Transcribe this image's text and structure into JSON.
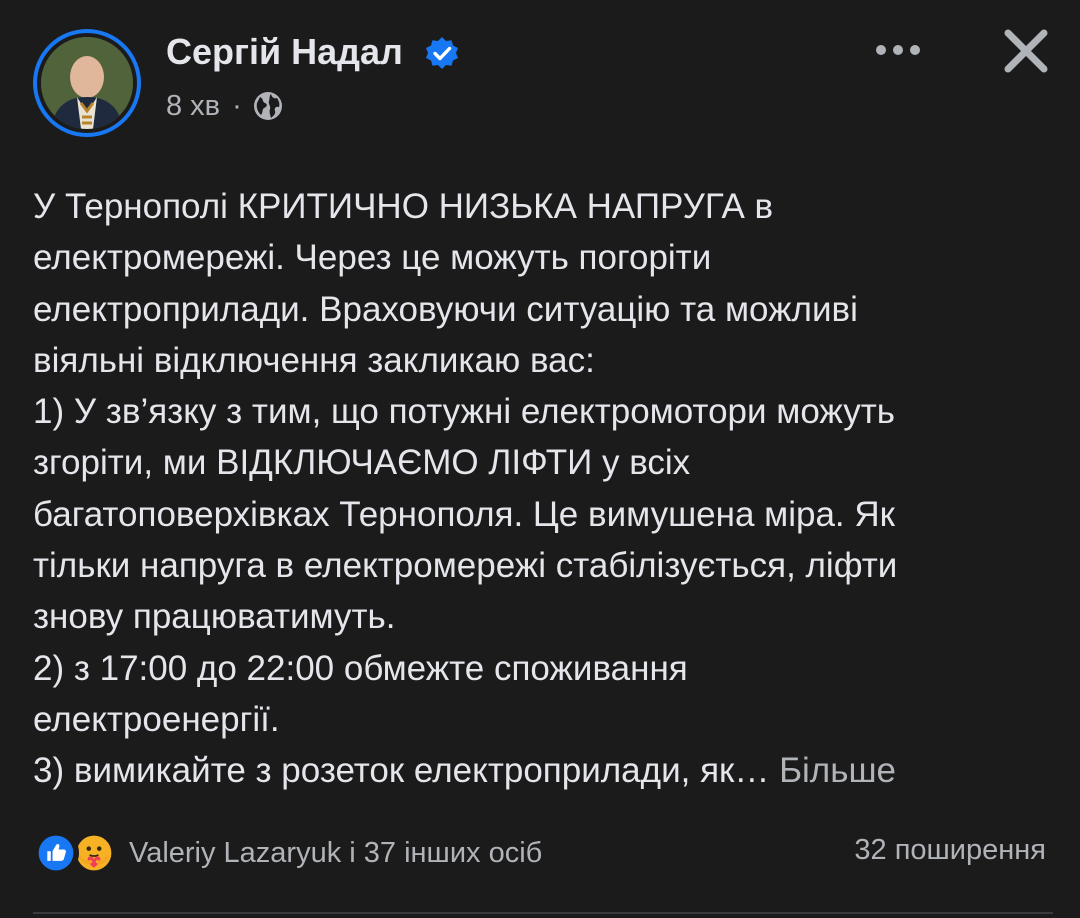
{
  "post": {
    "author": "Сергій Надал",
    "time": "8 хв",
    "separator": "·",
    "privacy_icon": "globe-icon",
    "verified_icon": "verified-badge-icon",
    "lines": [
      "У Тернополі КРИТИЧНО НИЗЬКА НАПРУГА в",
      "електромережі. Через це можуть погоріти",
      "електроприлади. Враховуючи ситуацію та можливі",
      "віяльні відключення закликаю вас:",
      "1) У зв’язку з тим, що потужні електромотори можуть",
      "згоріти, ми ВІДКЛЮЧАЄМО ЛІФТИ у всіх",
      "багатоповерхівках Тернополя. Це вимушена міра. Як",
      "тільки напруга в електромережі стабілізується, ліфти",
      "знову працюватимуть.",
      "2) з 17:00 до 22:00 обмежте споживання",
      "електроенергії.",
      "3) вимикайте з розеток електроприлади, як… "
    ],
    "see_more": "Більше"
  },
  "engagement": {
    "reactions": [
      "like-icon",
      "care-icon"
    ],
    "reactors_text": "Valeriy Lazaryuk і 37 інших осіб",
    "shares_text": "32 поширення"
  },
  "colors": {
    "background": "#1b1b1b",
    "text": "#e4e6eb",
    "secondary": "#b0b3b8",
    "accent": "#1877f2"
  }
}
